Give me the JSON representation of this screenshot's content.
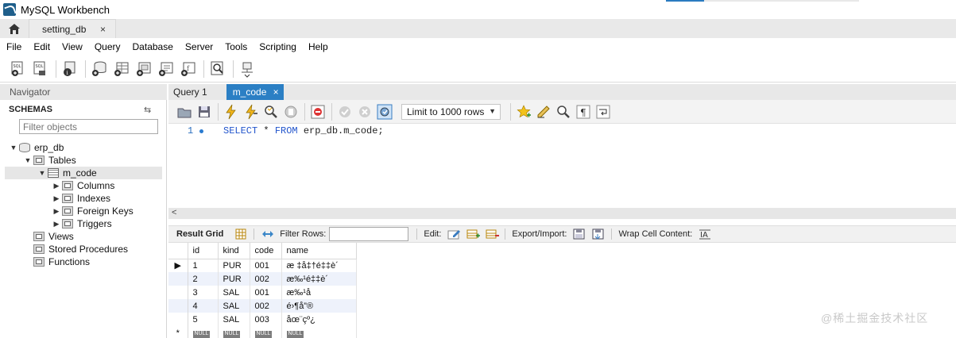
{
  "window": {
    "title": "MySQL Workbench"
  },
  "connection_tabs": [
    {
      "label": "setting_db",
      "close": "×"
    }
  ],
  "menu": [
    "File",
    "Edit",
    "View",
    "Query",
    "Database",
    "Server",
    "Tools",
    "Scripting",
    "Help"
  ],
  "main_toolbar": {
    "icons": [
      "new-sql-tab-icon",
      "open-sql-script-icon",
      "inspector-icon",
      "create-schema-icon",
      "create-table-icon",
      "create-view-icon",
      "create-procedure-icon",
      "create-function-icon",
      "search-table-data-icon",
      "reconnect-icon"
    ]
  },
  "navigator": {
    "header": "Navigator",
    "schemas_label": "SCHEMAS",
    "filter_placeholder": "Filter objects",
    "tree": [
      {
        "label": "erp_db",
        "level": 0,
        "expanded": true,
        "icon": "database-icon"
      },
      {
        "label": "Tables",
        "level": 1,
        "expanded": true,
        "icon": "tables-folder-icon"
      },
      {
        "label": "m_code",
        "level": 2,
        "expanded": true,
        "icon": "table-icon",
        "selected": true
      },
      {
        "label": "Columns",
        "level": 3,
        "expanded": false,
        "icon": "columns-icon"
      },
      {
        "label": "Indexes",
        "level": 3,
        "expanded": false,
        "icon": "indexes-icon"
      },
      {
        "label": "Foreign Keys",
        "level": 3,
        "expanded": false,
        "icon": "foreign-keys-icon"
      },
      {
        "label": "Triggers",
        "level": 3,
        "expanded": false,
        "icon": "triggers-icon"
      },
      {
        "label": "Views",
        "level": 1,
        "expanded": null,
        "icon": "views-folder-icon"
      },
      {
        "label": "Stored Procedures",
        "level": 1,
        "expanded": null,
        "icon": "procedures-folder-icon"
      },
      {
        "label": "Functions",
        "level": 1,
        "expanded": null,
        "icon": "functions-folder-icon"
      }
    ]
  },
  "query_tabs": [
    {
      "label": "Query 1",
      "active": false
    },
    {
      "label": "m_code",
      "active": true,
      "close": "×"
    }
  ],
  "sql_toolbar": {
    "limit_label": "Limit to 1000 rows"
  },
  "editor": {
    "line_number": "1",
    "tokens": [
      {
        "text": "SELECT",
        "kind": "kw"
      },
      {
        "text": " * ",
        "kind": "id"
      },
      {
        "text": "FROM",
        "kind": "kw"
      },
      {
        "text": " erp_db.m_code;",
        "kind": "id"
      }
    ]
  },
  "result_toolbar": {
    "result_grid": "Result Grid",
    "filter_rows": "Filter Rows:",
    "edit": "Edit:",
    "export_import": "Export/Import:",
    "wrap": "Wrap Cell Content:"
  },
  "grid": {
    "columns": [
      "id",
      "kind",
      "code",
      "name"
    ],
    "rows": [
      [
        "1",
        "PUR",
        "001",
        "æ ‡å‡†é‡‡è´­"
      ],
      [
        "2",
        "PUR",
        "002",
        "æ‰¹é‡‡è´­"
      ],
      [
        "3",
        "SAL",
        "001",
        "æ‰¹å"
      ],
      [
        "4",
        "SAL",
        "002",
        "é›¶å”®"
      ],
      [
        "5",
        "SAL",
        "003",
        "åœ¨çº¿"
      ]
    ],
    "null_label": "NULL",
    "new_row_marker": "*"
  },
  "watermark": "@稀土掘金技术社区"
}
